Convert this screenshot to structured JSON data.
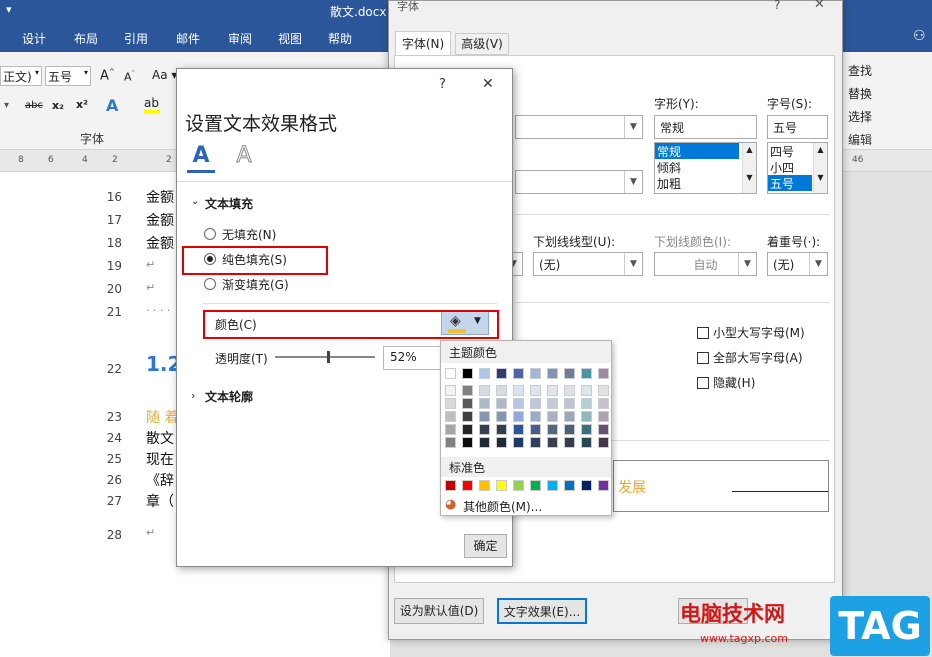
{
  "word": {
    "title": "散文.docx",
    "tabs": [
      "设计",
      "布局",
      "引用",
      "邮件",
      "审阅",
      "视图",
      "帮助"
    ],
    "font_combo": "正文)",
    "size_combo": "五号",
    "font_group_label": "字体",
    "editing": [
      "查找",
      "替换",
      "选择",
      "编辑"
    ],
    "ruler_left": [
      "8",
      "6",
      "4",
      "2",
      "2"
    ],
    "ruler_right": "46",
    "lines": [
      {
        "num": "16",
        "text": "金额"
      },
      {
        "num": "17",
        "text": "金额"
      },
      {
        "num": "18",
        "text": "金额"
      },
      {
        "num": "19",
        "text": "↵"
      },
      {
        "num": "20",
        "text": "↵"
      },
      {
        "num": "21",
        "text": "· · · ·"
      },
      {
        "num": "22",
        "text": "1.2"
      },
      {
        "num": "23",
        "text": "随 着"
      },
      {
        "num": "24",
        "text": "散文"
      },
      {
        "num": "25",
        "text": "现在"
      },
      {
        "num": "26",
        "text": "《辞"
      },
      {
        "num": "27",
        "text": "章（"
      },
      {
        "num": "28",
        "text": "↵"
      }
    ]
  },
  "font_dialog": {
    "title": "字体",
    "help": "?",
    "tabs": [
      "字体(N)",
      "高级(V)"
    ],
    "style_label": "字形(Y):",
    "style_value": "常规",
    "style_list": [
      "常规",
      "倾斜",
      "加粗"
    ],
    "size_label": "字号(S):",
    "size_value": "五号",
    "size_list": [
      "四号",
      "小四",
      "五号"
    ],
    "underline_style_label": "下划线线型(U):",
    "underline_style_value": "(无)",
    "underline_color_label": "下划线颜色(I):",
    "underline_color_value": "自动",
    "emphasis_label": "着重号(·):",
    "emphasis_value": "(无)",
    "checks": [
      "小型大写字母(M)",
      "全部大写字母(A)",
      "隐藏(H)"
    ],
    "preview_text": "发展",
    "set_default": "设为默认值(D)",
    "text_effects": "文字效果(E)..."
  },
  "effects_dialog": {
    "help": "?",
    "close": "✕",
    "title": "设置文本效果格式",
    "fill_section": "文本填充",
    "fill_options": [
      "无填充(N)",
      "纯色填充(S)",
      "渐变填充(G)"
    ],
    "selected_fill": "纯色填充(S)",
    "color_label": "颜色(C)",
    "transparency_label": "透明度(T)",
    "transparency_value": "52%",
    "transparency": 0.52,
    "outline_section": "文本轮廓",
    "ok": "确定"
  },
  "color_popup": {
    "theme_label": "主题颜色",
    "standard_label": "标准色",
    "more_colors": "其他颜色(M)...",
    "theme_top": [
      "#ffffff",
      "#000000",
      "#e7e6e6",
      "#44546a",
      "#4472c4",
      "#ed7d31",
      "#a5a5a5",
      "#ffc000",
      "#5b9bd5",
      "#70ad47"
    ],
    "theme_columns": [
      [
        "#f2f2f2",
        "#d9d9d9",
        "#bfbfbf",
        "#a6a6a6",
        "#808080"
      ],
      [
        "#808080",
        "#595959",
        "#404040",
        "#262626",
        "#0d0d0d"
      ],
      [
        "#d6dce5",
        "#adb9ca",
        "#8497b0",
        "#333f50",
        "#222a35"
      ],
      [
        "#d6dce4",
        "#acb9ca",
        "#8497b0",
        "#323f4f",
        "#222a35"
      ],
      [
        "#dae3f3",
        "#b4c7e7",
        "#8faadc",
        "#2f5597",
        "#203864"
      ],
      [
        "#dee3ee",
        "#bcc7dd",
        "#9aabcc",
        "#465e8c",
        "#2e3f5d"
      ],
      [
        "#e1e5ea",
        "#c3cbd5",
        "#a6b1c1",
        "#56667d",
        "#393f53"
      ],
      [
        "#dde2e8",
        "#bbc5d1",
        "#99a8ba",
        "#4d5e77",
        "#333f4f"
      ],
      [
        "#d9e7ea",
        "#b3cfd6",
        "#8db7c1",
        "#3d6e7b",
        "#284952"
      ],
      [
        "#e4e0e6",
        "#c9c1cd",
        "#afa3b4",
        "#665270",
        "#44374a"
      ]
    ],
    "theme_top_actual": [
      "#ffffff",
      "#000000",
      "#adc3e8",
      "#2e3f6e",
      "#5065a8",
      "#a4b5d9",
      "#8393b3",
      "#6d7d99",
      "#4a94a4",
      "#9b8aa0"
    ],
    "standard": [
      "#c00000",
      "#ff0000",
      "#ffc000",
      "#ffff00",
      "#92d050",
      "#00b050",
      "#00b0f0",
      "#0070c0",
      "#002060",
      "#7030a0"
    ]
  },
  "watermark": {
    "text": "电脑技术网",
    "url": "www.tagxp.com",
    "tag": "TAG"
  }
}
